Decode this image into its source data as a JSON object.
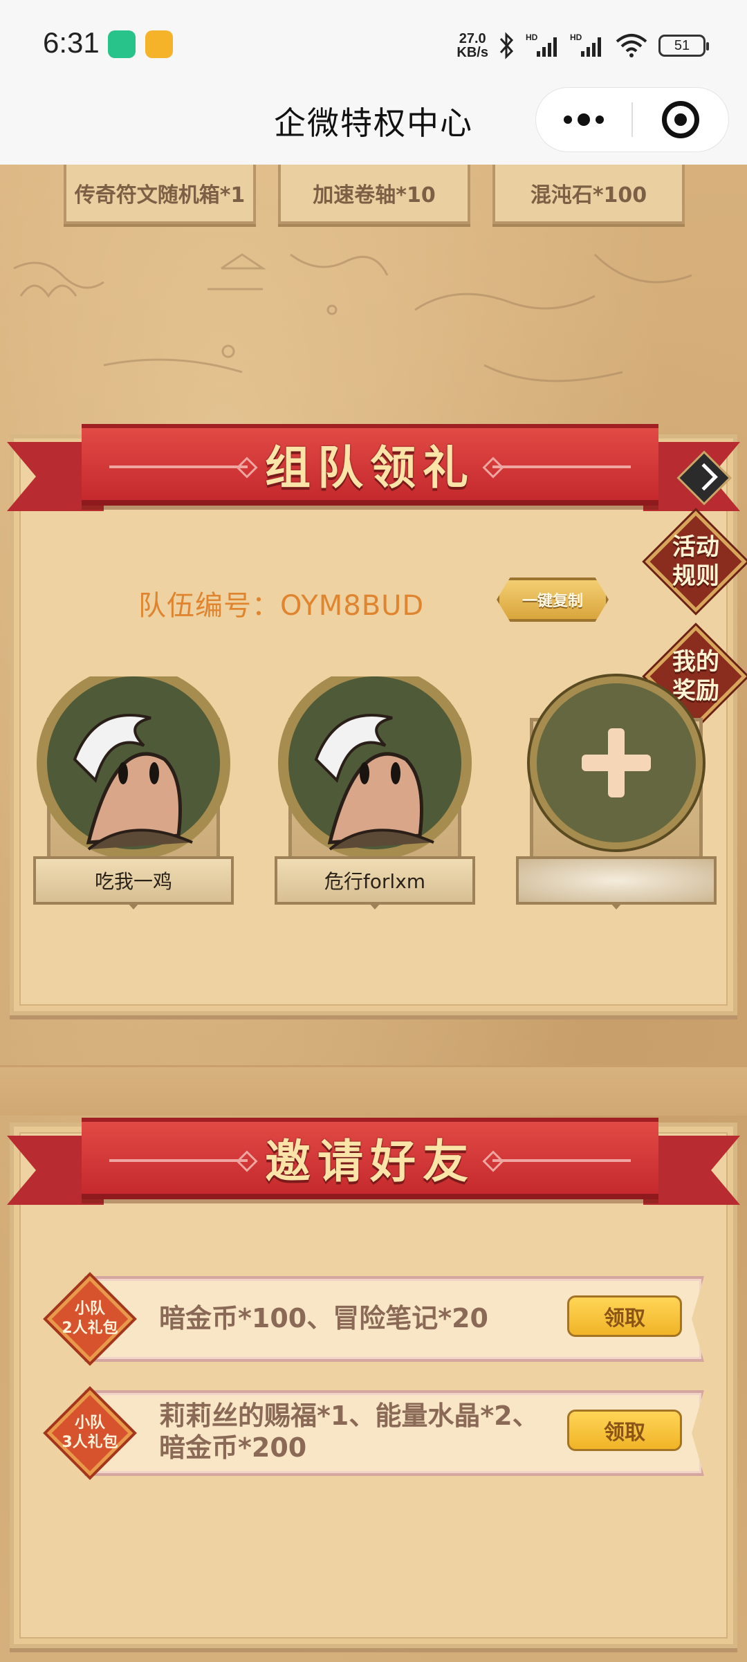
{
  "status": {
    "time": "6:31",
    "net_speed_value": "27.0",
    "net_speed_unit": "KB/s",
    "battery": "51"
  },
  "nav": {
    "title": "企微特权中心"
  },
  "top_rewards": [
    {
      "label": "传奇符文随机箱*1"
    },
    {
      "label": "加速卷轴*10"
    },
    {
      "label": "混沌石*100"
    }
  ],
  "team_section": {
    "title": "组队领礼",
    "team_code": "队伍编号：OYM8BUD",
    "copy_button": "一键复制",
    "rules_button": "活动\n规则",
    "rules_line1": "活动",
    "rules_line2": "规则",
    "my_rewards_line1": "我的",
    "my_rewards_line2": "奖励",
    "members": [
      {
        "name": "吃我一鸡"
      },
      {
        "name": "危行forlxm"
      },
      {
        "name": ""
      }
    ]
  },
  "invite_section": {
    "title": "邀请好友",
    "gifts": [
      {
        "badge_line1": "小队",
        "badge_line2": "2人礼包",
        "text_line1": "暗金币*100、冒险笔记*20",
        "text_line2": "",
        "button": "领取"
      },
      {
        "badge_line1": "小队",
        "badge_line2": "3人礼包",
        "text_line1": "莉莉丝的赐福*1、能量水晶*2、",
        "text_line2": "暗金币*200",
        "button": "领取"
      }
    ]
  },
  "colors": {
    "ribbon_red": "#c5292d",
    "panel_bg": "#eed2a1",
    "team_code_orange": "#e0852f",
    "claim_yellow": "#f0b427"
  }
}
